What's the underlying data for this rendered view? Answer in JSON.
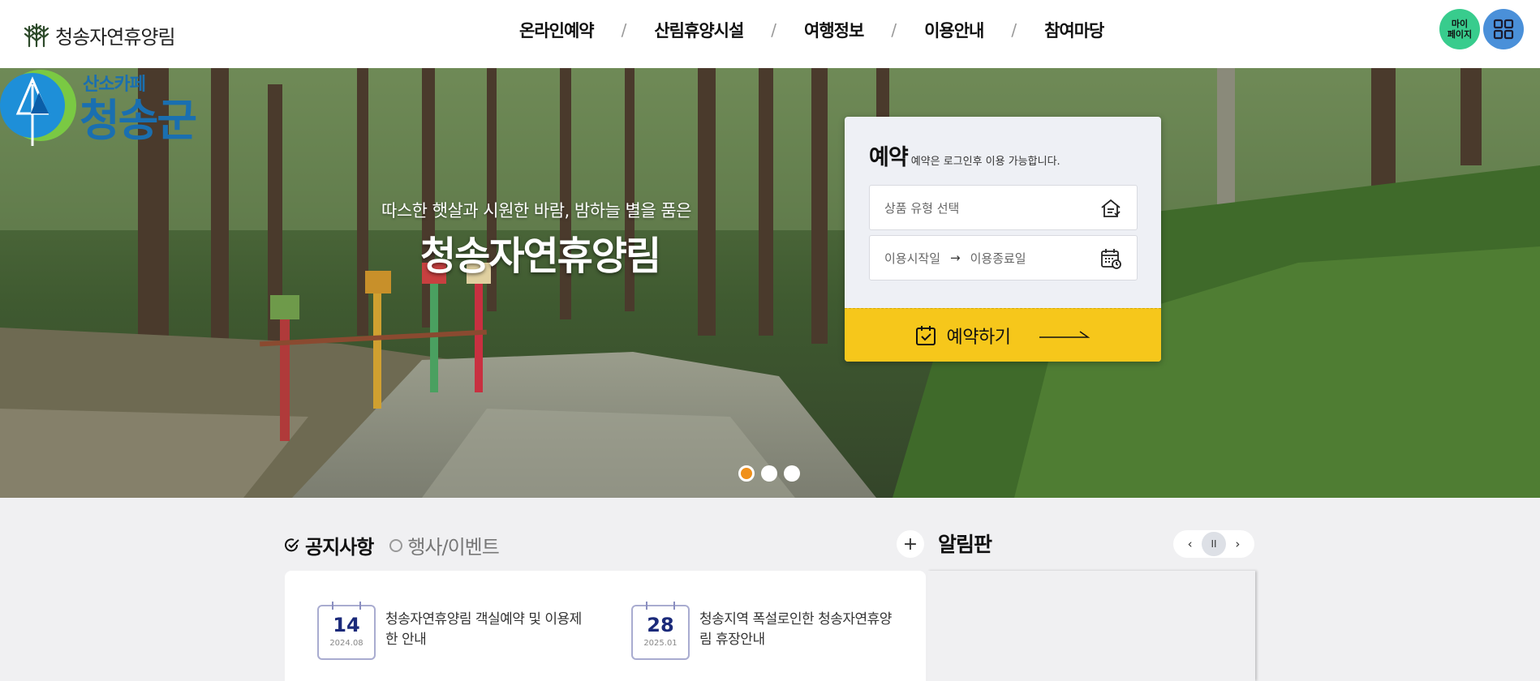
{
  "header": {
    "brand": "청송자연휴양림",
    "nav": [
      "온라인예약",
      "산림휴양시설",
      "여행정보",
      "이용안내",
      "참여마당"
    ],
    "separator": "/",
    "mypage_line1": "마이",
    "mypage_line2": "페이지"
  },
  "hero": {
    "county_sub": "산소카페",
    "county_main": "청송군",
    "subtitle": "따스한 햇살과 시원한 바람, 밤하늘 별을 품은",
    "title": "청송자연휴양림",
    "slides": 3,
    "active_slide": 1
  },
  "reservation": {
    "title": "예약",
    "note": "예약은 로그인후 이용 가능합니다.",
    "product_placeholder": "상품 유형 선택",
    "start_placeholder": "이용시작일",
    "arrow": "→",
    "end_placeholder": "이용종료일",
    "button_label": "예약하기"
  },
  "notices": {
    "tab_active": "공지사항",
    "tab_inactive": "행사/이벤트",
    "plus": "+",
    "items": [
      {
        "day": "14",
        "ym": "2024.08",
        "text": "청송자연휴양림 객실예약 및 이용제한 안내"
      },
      {
        "day": "28",
        "ym": "2025.01",
        "text": "청송지역 폭설로인한 청송자연휴양림 휴장안내"
      }
    ]
  },
  "board": {
    "title": "알림판",
    "prev": "‹",
    "pause": "II",
    "next": "›"
  },
  "colors": {
    "accent_yellow": "#f6c71b",
    "mypage_green": "#38cc8d",
    "menu_blue": "#4a90d9",
    "dot_active": "#f0901a"
  }
}
